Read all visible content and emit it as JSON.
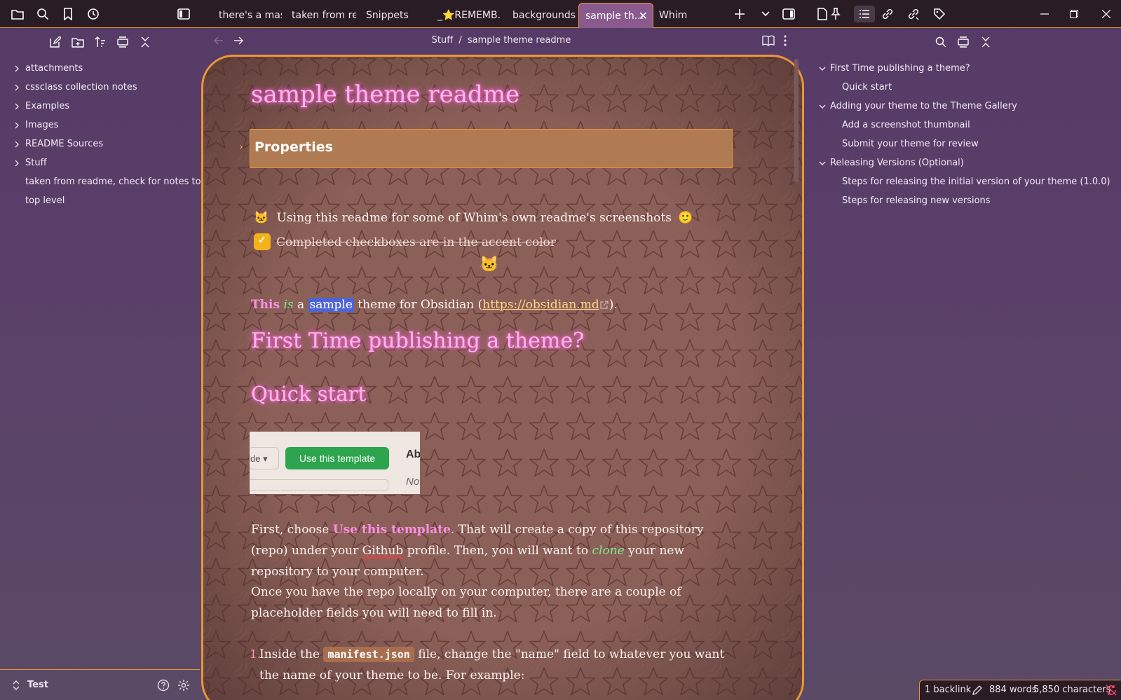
{
  "tabs": [
    {
      "label": "there's a mas..."
    },
    {
      "label": "taken from re..."
    },
    {
      "label": "Snippets"
    },
    {
      "label": "_⭐REMEMB..."
    },
    {
      "label": "backgrounds"
    },
    {
      "label": "sample th..."
    },
    {
      "label": "Whim"
    }
  ],
  "left_sidebar": {
    "items": [
      {
        "label": "attachments",
        "folder": true
      },
      {
        "label": "cssclass collection notes",
        "folder": true
      },
      {
        "label": "Examples",
        "folder": true
      },
      {
        "label": "Images",
        "folder": true
      },
      {
        "label": "README Sources",
        "folder": true
      },
      {
        "label": "Stuff",
        "folder": true
      },
      {
        "label": "taken from readme, check for notes to...",
        "folder": false
      },
      {
        "label": "top level",
        "folder": false
      }
    ],
    "vault_name": "Test"
  },
  "editor": {
    "breadcrumb_folder": "Stuff",
    "breadcrumb_sep": "/",
    "breadcrumb_note": "sample theme readme",
    "title": "sample theme readme",
    "properties_label": "Properties",
    "cat_emoji": "🐱",
    "line1": "Using this readme for some of Whim's own readme's screenshots",
    "smiley": "🙂",
    "checkbox_text": "Completed checkboxes are in the accent color",
    "checkmark": "✓",
    "cat_center": "🐱",
    "intro": {
      "this": "This",
      "is": "is",
      "a": "a",
      "sample": "sample",
      "rest": "theme for Obsidian (",
      "link": "https://obsidian.md",
      "close": ")."
    },
    "h1": "First Time publishing a theme?",
    "h2": "Quick start",
    "template_image": {
      "left_btn": "de ▾",
      "button": "Use this template",
      "ab": "Ab",
      "no": "No"
    },
    "para1": {
      "a": "First, choose ",
      "b": "Use this template",
      "c": ". That will create a copy of this repository (repo) under your ",
      "d": "Github",
      "e": " profile. Then, you will want to ",
      "f": "clone",
      "g": " your new repository to your computer."
    },
    "para2": "Once you have the repo locally on your computer, there are a couple of placeholder fields you will need to fill in.",
    "list1": {
      "num": "1.",
      "a": "Inside the ",
      "code": "manifest.json",
      "b": " file, change the \"name\" field to whatever you want the name of your theme to be. For example:"
    }
  },
  "outline": [
    {
      "label": "First Time publishing a theme?",
      "level": 1,
      "collapsible": true
    },
    {
      "label": "Quick start",
      "level": 2,
      "collapsible": false
    },
    {
      "label": "Adding your theme to the Theme Gallery",
      "level": 1,
      "collapsible": true
    },
    {
      "label": "Add a screenshot thumbnail",
      "level": 2,
      "collapsible": false
    },
    {
      "label": "Submit your theme for review",
      "level": 2,
      "collapsible": false
    },
    {
      "label": "Releasing Versions (Optional)",
      "level": 1,
      "collapsible": true
    },
    {
      "label": "Steps for releasing the initial version of your theme (1.0.0)",
      "level": 2,
      "collapsible": false
    },
    {
      "label": "Steps for releasing new versions",
      "level": 2,
      "collapsible": false
    }
  ],
  "status_bar": {
    "backlinks": "1 backlink",
    "words": "884 words",
    "characters": "5,850 characters"
  },
  "colors": {
    "accent": "#e8963a",
    "heading_glow": "#ff5fd6",
    "checkbox": "#f4b21a",
    "template_button": "#2da44e"
  }
}
